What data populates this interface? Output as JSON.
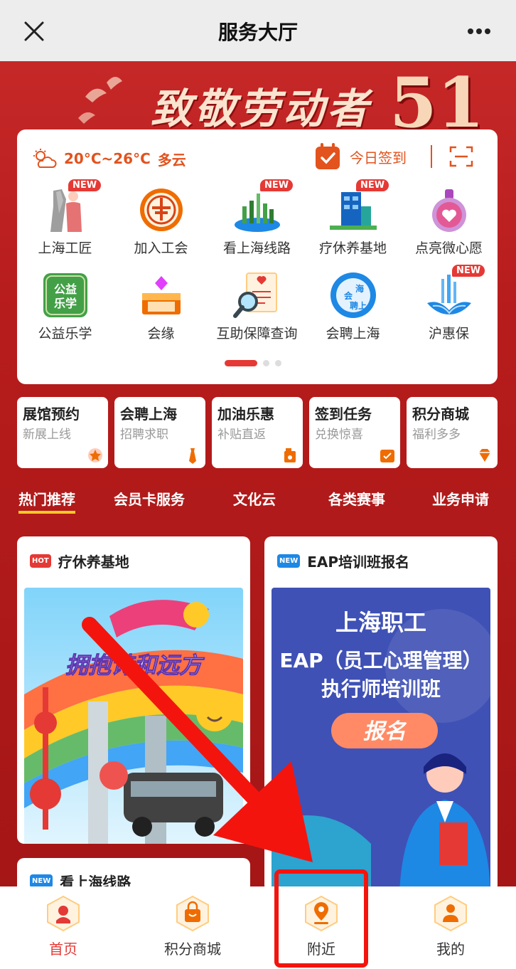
{
  "header": {
    "title": "服务大厅"
  },
  "banner": {
    "headline": "致敬劳动者",
    "number": "51"
  },
  "weather": {
    "temperature": "20°C~26°C",
    "condition": "多云"
  },
  "checkin": {
    "label": "今日签到"
  },
  "services": [
    {
      "label": "上海工匠",
      "new": true,
      "icon": "craftsman-statue-icon"
    },
    {
      "label": "加入工会",
      "new": false,
      "icon": "union-emblem-icon"
    },
    {
      "label": "看上海线路",
      "new": true,
      "icon": "shanghai-skyline-icon"
    },
    {
      "label": "疗休养基地",
      "new": true,
      "icon": "resort-building-icon"
    },
    {
      "label": "点亮微心愿",
      "new": false,
      "icon": "wish-bottle-icon"
    },
    {
      "label": "公益乐学",
      "new": false,
      "icon": "charity-learning-icon"
    },
    {
      "label": "会缘",
      "new": false,
      "icon": "gift-box-icon"
    },
    {
      "label": "互助保障查询",
      "new": false,
      "icon": "insurance-search-icon"
    },
    {
      "label": "会聘上海",
      "new": false,
      "icon": "recruitment-globe-icon"
    },
    {
      "label": "沪惠保",
      "new": true,
      "icon": "lotus-city-icon"
    }
  ],
  "quick_links": [
    {
      "title": "展馆预约",
      "subtitle": "新展上线",
      "icon": "star-badge-icon"
    },
    {
      "title": "会聘上海",
      "subtitle": "招聘求职",
      "icon": "tie-icon"
    },
    {
      "title": "加油乐惠",
      "subtitle": "补贴直返",
      "icon": "fuel-can-icon"
    },
    {
      "title": "签到任务",
      "subtitle": "兑换惊喜",
      "icon": "calendar-check-icon"
    },
    {
      "title": "积分商城",
      "subtitle": "福利多多",
      "icon": "diamond-icon"
    }
  ],
  "category_tabs": [
    "热门推荐",
    "会员卡服务",
    "文化云",
    "各类赛事",
    "业务申请"
  ],
  "feed": [
    {
      "badge": "HOT",
      "badge_color": "#e53935",
      "title": "疗休养基地",
      "image_text": "拥抱诗和远方"
    },
    {
      "badge": "NEW",
      "badge_color": "#1e88e5",
      "title": "EAP培训班报名",
      "image_line1": "上海职工",
      "image_line2": "EAP（员工心理管理）",
      "image_line3": "执行师培训班",
      "image_button": "报名"
    },
    {
      "badge": "NEW",
      "badge_color": "#1e88e5",
      "title": "看上海线路"
    }
  ],
  "bottom_nav": [
    {
      "label": "首页",
      "icon": "home-icon",
      "active": true
    },
    {
      "label": "积分商城",
      "icon": "shopping-bag-icon",
      "active": false
    },
    {
      "label": "附近",
      "icon": "location-pin-icon",
      "active": false
    },
    {
      "label": "我的",
      "icon": "profile-icon",
      "active": false
    }
  ],
  "badge_text": "NEW",
  "colors": {
    "accent": "#e53935",
    "orange": "#e2531e",
    "bg_red": "#b71c1c"
  }
}
